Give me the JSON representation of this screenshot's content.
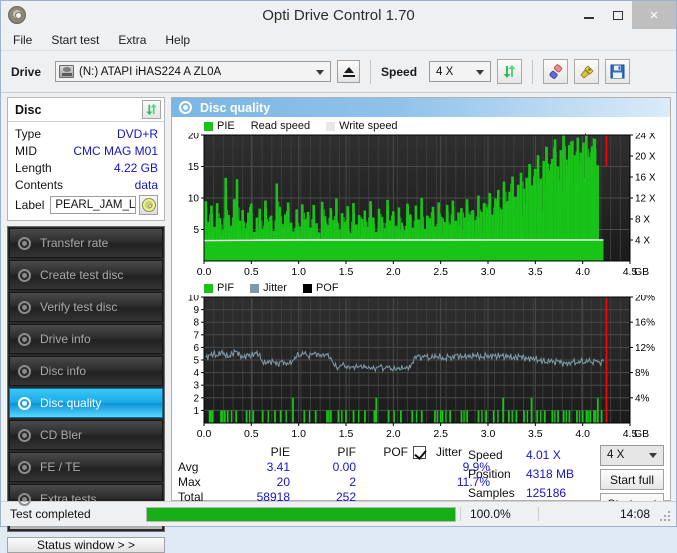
{
  "window": {
    "title": "Opti Drive Control 1.70",
    "app_icon": "disc-icon",
    "minimize": "minimize-icon",
    "maximize": "maximize-icon",
    "close": "×"
  },
  "menu": [
    "File",
    "Start test",
    "Extra",
    "Help"
  ],
  "toolbar": {
    "drive_label": "Drive",
    "drive_value": "(N:)  ATAPI iHAS224  A ZL0A",
    "eject": "eject-icon",
    "speed_label": "Speed",
    "speed_value": "4 X",
    "refresh": "refresh-icon",
    "eraser": "eraser-icon",
    "plug": "plug-icon",
    "save": "save-icon"
  },
  "disc": {
    "header": "Disc",
    "refresh": "refresh-icon",
    "rows": [
      {
        "key": "Type",
        "value": "DVD+R"
      },
      {
        "key": "MID",
        "value": "CMC MAG M01"
      },
      {
        "key": "Length",
        "value": "4.22 GB"
      },
      {
        "key": "Contents",
        "value": "data"
      }
    ],
    "label_key": "Label",
    "label_value": "PEARL_JAM_LI\\",
    "cd_button": "cd-icon"
  },
  "sidebar": {
    "items": [
      {
        "label": "Transfer rate",
        "selected": false
      },
      {
        "label": "Create test disc",
        "selected": false
      },
      {
        "label": "Verify test disc",
        "selected": false
      },
      {
        "label": "Drive info",
        "selected": false
      },
      {
        "label": "Disc info",
        "selected": false
      },
      {
        "label": "Disc quality",
        "selected": true
      },
      {
        "label": "CD Bler",
        "selected": false
      },
      {
        "label": "FE / TE",
        "selected": false
      },
      {
        "label": "Extra tests",
        "selected": false
      }
    ],
    "status_window": "Status window > >"
  },
  "panel": {
    "title": "Disc quality",
    "icon": "disc-quality-icon"
  },
  "chart_data": [
    {
      "type": "area",
      "name": "pie-chart",
      "title": "",
      "legend": [
        {
          "label": "PIE",
          "color": "#19c419"
        },
        {
          "label": "Read speed",
          "color": "#ffffff"
        },
        {
          "label": "Write speed",
          "color": "#e8e8e8"
        }
      ],
      "legend_position": "top-left",
      "xlabel": "GB",
      "ylabel": "",
      "xlim": [
        0.0,
        4.5
      ],
      "xticks": [
        "0.0",
        "0.5",
        "1.0",
        "1.5",
        "2.0",
        "2.5",
        "3.0",
        "3.5",
        "4.0",
        "4.5"
      ],
      "xtick_values": [
        0.0,
        0.5,
        1.0,
        1.5,
        2.0,
        2.5,
        3.0,
        3.5,
        4.0,
        4.5
      ],
      "x_unit": "GB",
      "ylim": [
        0,
        20
      ],
      "yticks": [
        "5",
        "10",
        "15",
        "20"
      ],
      "ytick_values": [
        5,
        10,
        15,
        20
      ],
      "y2lim": [
        0,
        24
      ],
      "y2ticks": [
        "4 X",
        "8 X",
        "12 X",
        "16 X",
        "20 X",
        "24 X"
      ],
      "y2tick_values": [
        4,
        8,
        12,
        16,
        20,
        24
      ],
      "grid": true,
      "data_end_x": 4.22,
      "marker_x": 4.25,
      "marker_color": "#ff0000",
      "read_speed_series": {
        "name": "Read speed",
        "color": "#ffffff",
        "x": [
          0.0,
          0.5,
          1.0,
          1.5,
          2.0,
          2.5,
          3.0,
          3.5,
          4.0,
          4.22
        ],
        "values": [
          3.9,
          3.95,
          4.0,
          4.0,
          4.0,
          4.0,
          4.02,
          4.02,
          4.02,
          4.02
        ]
      },
      "pie_series": {
        "name": "PIE",
        "color": "#19c419",
        "baseline": 3.3,
        "x": [
          0.02,
          0.05,
          0.08,
          0.11,
          0.14,
          0.17,
          0.2,
          0.23,
          0.26,
          0.29,
          0.32,
          0.35,
          0.38,
          0.41,
          0.44,
          0.47,
          0.5,
          0.53,
          0.56,
          0.59,
          0.62,
          0.65,
          0.68,
          0.71,
          0.74,
          0.77,
          0.8,
          0.83,
          0.86,
          0.89,
          0.92,
          0.95,
          0.98,
          1.01,
          1.04,
          1.07,
          1.1,
          1.13,
          1.16,
          1.19,
          1.22,
          1.25,
          1.28,
          1.31,
          1.34,
          1.37,
          1.4,
          1.43,
          1.46,
          1.49,
          1.52,
          1.55,
          1.58,
          1.61,
          1.64,
          1.67,
          1.7,
          1.73,
          1.76,
          1.79,
          1.82,
          1.85,
          1.88,
          1.91,
          1.94,
          1.97,
          2.0,
          2.03,
          2.06,
          2.09,
          2.12,
          2.15,
          2.18,
          2.21,
          2.24,
          2.27,
          2.3,
          2.33,
          2.36,
          2.39,
          2.42,
          2.45,
          2.48,
          2.51,
          2.54,
          2.57,
          2.6,
          2.63,
          2.66,
          2.69,
          2.72,
          2.75,
          2.78,
          2.81,
          2.84,
          2.87,
          2.9,
          2.93,
          2.96,
          2.99,
          3.02,
          3.05,
          3.08,
          3.11,
          3.14,
          3.17,
          3.2,
          3.23,
          3.26,
          3.29,
          3.32,
          3.35,
          3.38,
          3.41,
          3.44,
          3.47,
          3.5,
          3.53,
          3.56,
          3.59,
          3.62,
          3.65,
          3.68,
          3.71,
          3.74,
          3.77,
          3.8,
          3.83,
          3.86,
          3.89,
          3.92,
          3.95,
          3.98,
          4.01,
          4.04,
          4.07,
          4.1,
          4.13,
          4.16,
          4.19,
          4.22
        ],
        "values": [
          9.5,
          6.2,
          8.8,
          5.4,
          9.2,
          6.8,
          4.9,
          13.2,
          7.3,
          5.6,
          9.8,
          13.0,
          6.4,
          8.1,
          5.2,
          7.7,
          9.1,
          4.6,
          6.9,
          8.3,
          5.1,
          9.6,
          6.3,
          7.2,
          4.8,
          12.3,
          8.6,
          5.9,
          7.4,
          9.3,
          6.1,
          4.7,
          8.2,
          5.5,
          9.0,
          6.6,
          7.8,
          5.3,
          8.9,
          6.0,
          4.5,
          9.4,
          7.1,
          5.7,
          8.4,
          6.5,
          9.9,
          5.0,
          7.6,
          6.2,
          8.7,
          4.4,
          9.2,
          5.8,
          7.3,
          6.7,
          8.0,
          5.4,
          9.5,
          6.9,
          4.6,
          8.3,
          7.0,
          5.2,
          9.7,
          6.4,
          7.9,
          5.6,
          8.5,
          6.1,
          4.9,
          9.1,
          7.4,
          5.3,
          8.8,
          6.6,
          10.0,
          5.1,
          7.2,
          6.8,
          8.6,
          5.5,
          9.3,
          7.0,
          6.2,
          8.9,
          5.8,
          9.6,
          6.4,
          7.7,
          8.4,
          6.9,
          9.8,
          7.3,
          8.1,
          6.5,
          10.4,
          7.8,
          9.2,
          8.5,
          10.8,
          7.4,
          9.9,
          11.3,
          8.2,
          12.6,
          9.5,
          11.0,
          13.4,
          10.2,
          12.1,
          14.0,
          11.5,
          13.2,
          15.4,
          12.0,
          14.6,
          16.8,
          13.1,
          15.9,
          18.1,
          14.4,
          16.2,
          19.3,
          15.0,
          17.6,
          20.0,
          16.1,
          18.4,
          19.0,
          16.8,
          19.6,
          17.2,
          18.8,
          19.9,
          16.5,
          18.2,
          19.4,
          15.2
        ]
      }
    },
    {
      "type": "line",
      "name": "pif-jitter-chart",
      "title": "",
      "legend": [
        {
          "label": "PIF",
          "color": "#19c419"
        },
        {
          "label": "Jitter",
          "color": "#7e9aa8"
        },
        {
          "label": "POF",
          "color": "#000000"
        }
      ],
      "legend_position": "top-left",
      "xlabel": "GB",
      "xlim": [
        0.0,
        4.5
      ],
      "xticks": [
        "0.0",
        "0.5",
        "1.0",
        "1.5",
        "2.0",
        "2.5",
        "3.0",
        "3.5",
        "4.0",
        "4.5"
      ],
      "xtick_values": [
        0.0,
        0.5,
        1.0,
        1.5,
        2.0,
        2.5,
        3.0,
        3.5,
        4.0,
        4.5
      ],
      "x_unit": "GB",
      "ylim": [
        0,
        10
      ],
      "yticks": [
        "1",
        "2",
        "3",
        "4",
        "5",
        "6",
        "7",
        "8",
        "9",
        "10"
      ],
      "ytick_values": [
        1,
        2,
        3,
        4,
        5,
        6,
        7,
        8,
        9,
        10
      ],
      "y2lim": [
        0,
        20
      ],
      "y2ticks": [
        "4%",
        "8%",
        "12%",
        "16%",
        "20%"
      ],
      "y2tick_values": [
        4,
        8,
        12,
        16,
        20
      ],
      "grid": true,
      "marker_x": 4.25,
      "marker_color": "#ff0000",
      "jitter_series": {
        "name": "Jitter",
        "color": "#7e9aa8",
        "x": [
          0.02,
          0.06,
          0.1,
          0.14,
          0.18,
          0.22,
          0.26,
          0.3,
          0.34,
          0.38,
          0.42,
          0.46,
          0.5,
          0.54,
          0.58,
          0.62,
          0.66,
          0.7,
          0.74,
          0.78,
          0.82,
          0.86,
          0.9,
          0.94,
          0.98,
          1.02,
          1.06,
          1.1,
          1.14,
          1.18,
          1.22,
          1.26,
          1.3,
          1.34,
          1.38,
          1.42,
          1.46,
          1.5,
          1.54,
          1.58,
          1.62,
          1.66,
          1.7,
          1.74,
          1.78,
          1.82,
          1.86,
          1.9,
          1.94,
          1.98,
          2.02,
          2.06,
          2.1,
          2.14,
          2.18,
          2.22,
          2.26,
          2.3,
          2.34,
          2.38,
          2.42,
          2.46,
          2.5,
          2.54,
          2.58,
          2.62,
          2.66,
          2.7,
          2.74,
          2.78,
          2.82,
          2.86,
          2.9,
          2.94,
          2.98,
          3.02,
          3.06,
          3.1,
          3.14,
          3.18,
          3.22,
          3.26,
          3.3,
          3.34,
          3.38,
          3.42,
          3.46,
          3.5,
          3.54,
          3.58,
          3.62,
          3.66,
          3.7,
          3.74,
          3.78,
          3.82,
          3.86,
          3.9,
          3.94,
          3.98,
          4.02,
          4.06,
          4.1,
          4.14,
          4.18,
          4.22
        ],
        "values": [
          5.2,
          5.4,
          5.5,
          5.3,
          5.6,
          5.4,
          5.2,
          5.5,
          5.7,
          5.4,
          5.2,
          5.5,
          5.3,
          5.6,
          5.4,
          4.8,
          4.7,
          4.9,
          4.8,
          4.7,
          4.9,
          4.8,
          4.7,
          5.0,
          5.3,
          5.4,
          5.5,
          5.3,
          5.4,
          5.6,
          5.3,
          5.5,
          5.4,
          5.2,
          4.5,
          4.4,
          4.6,
          4.5,
          4.3,
          4.5,
          4.4,
          4.6,
          4.4,
          4.5,
          4.3,
          4.4,
          4.5,
          4.3,
          4.4,
          4.3,
          4.2,
          4.4,
          4.3,
          4.5,
          4.4,
          5.2,
          5.3,
          5.2,
          5.3,
          5.1,
          5.2,
          5.3,
          5.2,
          5.1,
          5.3,
          5.2,
          5.4,
          5.3,
          5.2,
          5.3,
          5.2,
          5.4,
          5.3,
          5.2,
          5.4,
          5.3,
          5.4,
          5.3,
          5.4,
          5.2,
          5.3,
          5.1,
          5.2,
          5.3,
          5.2,
          5.1,
          5.2,
          5.1,
          5.0,
          4.9,
          4.8,
          4.9,
          4.8,
          4.9,
          4.8,
          4.7,
          4.8,
          4.9,
          4.8,
          4.9,
          4.8,
          4.9,
          4.8,
          4.9,
          4.8,
          4.9
        ]
      },
      "pif_series": {
        "name": "PIF",
        "color": "#19c419",
        "x": [
          0.06,
          0.09,
          0.18,
          0.22,
          0.25,
          0.34,
          0.45,
          0.52,
          0.62,
          0.75,
          0.81,
          0.94,
          1.06,
          1.18,
          1.3,
          1.34,
          1.42,
          1.5,
          1.58,
          1.7,
          1.8,
          1.82,
          1.95,
          2.08,
          2.2,
          2.3,
          2.44,
          2.5,
          2.52,
          2.6,
          2.72,
          2.78,
          2.9,
          2.98,
          3.06,
          3.16,
          3.22,
          3.3,
          3.38,
          3.46,
          3.52,
          3.6,
          3.68,
          3.74,
          3.8,
          3.86,
          3.94,
          4.0,
          4.04,
          4.08,
          4.12,
          4.16,
          4.2
        ],
        "values": [
          1,
          1,
          1,
          1,
          1,
          1,
          1,
          1,
          1,
          1,
          1,
          2,
          1,
          1,
          1,
          1,
          1,
          1,
          1,
          1,
          1,
          2,
          1,
          1,
          1,
          1,
          1,
          1,
          1,
          1,
          1,
          1,
          1,
          1,
          1,
          2,
          1,
          1,
          1,
          2,
          1,
          1,
          1,
          1,
          1,
          1,
          1,
          1,
          1,
          1,
          1,
          2,
          1
        ]
      }
    }
  ],
  "stats": {
    "columns": [
      "PIE",
      "PIF",
      "POF",
      "Jitter"
    ],
    "jitter_checkbox": true,
    "rows": [
      {
        "key": "Avg",
        "pie": "3.41",
        "pif": "0.00",
        "pof": "",
        "jitter": "9.9%"
      },
      {
        "key": "Max",
        "pie": "20",
        "pif": "2",
        "pof": "",
        "jitter": "11.7%"
      },
      {
        "key": "Total",
        "pie": "58918",
        "pif": "252",
        "pof": "",
        "jitter": ""
      }
    ],
    "info": [
      {
        "key": "Speed",
        "value": "4.01 X"
      },
      {
        "key": "Position",
        "value": "4318 MB"
      },
      {
        "key": "Samples",
        "value": "125186"
      }
    ],
    "speed_select": "4 X",
    "start_full": "Start full",
    "start_part": "Start part"
  },
  "statusbar": {
    "text": "Test completed",
    "progress": 100,
    "percent": "100.0%",
    "time": "14:08"
  },
  "colors": {
    "pie_green": "#19c419",
    "jitter_blue": "#7e9aa8",
    "marker_red": "#ff0000",
    "accent_blue": "#1515c4",
    "panel_header": "#7cb6e4",
    "selected_nav": "#19a9e8",
    "plot_bg": "#2b2b2b",
    "progress_green": "#16b016"
  }
}
